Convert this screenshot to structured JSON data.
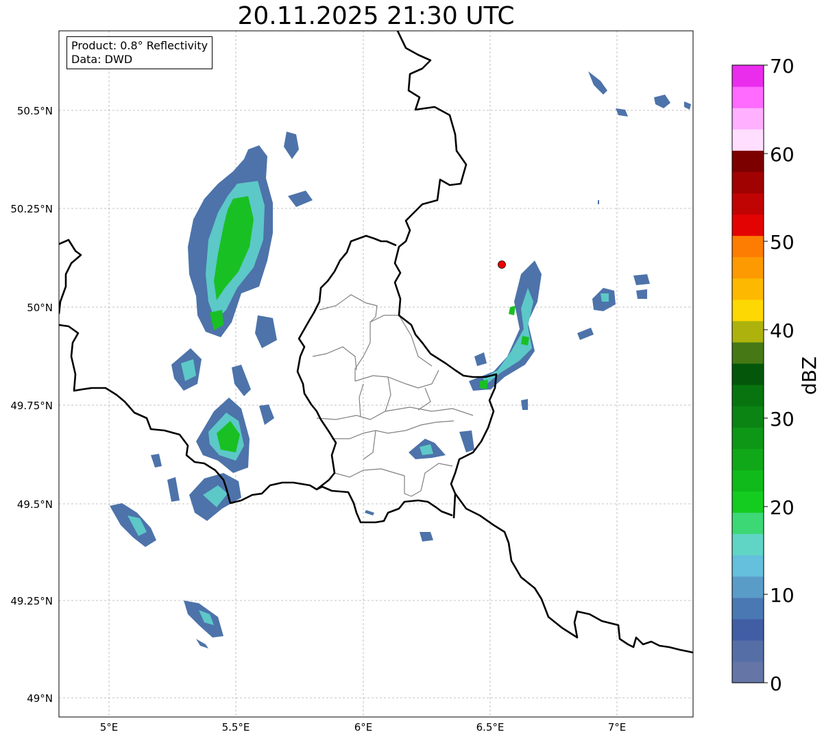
{
  "title": "20.11.2025 21:30 UTC",
  "info": {
    "product": "Product: 0.8° Reflectivity",
    "source": "Data: DWD"
  },
  "lat_axis": {
    "ticks": [
      "50.5°N",
      "50.25°N",
      "50°N",
      "49.75°N",
      "49.5°N",
      "49.25°N",
      "49°N"
    ]
  },
  "lon_axis": {
    "ticks": [
      "5°E",
      "5.5°E",
      "6°E",
      "6.5°E",
      "7°E"
    ]
  },
  "map_extent": {
    "lon": [
      4.8,
      7.3
    ],
    "lat": [
      48.95,
      50.7
    ]
  },
  "marker": {
    "lon": 6.545,
    "lat": 50.11,
    "color": "#ee0000"
  },
  "colorbar": {
    "label": "dBZ",
    "range": [
      0,
      70
    ],
    "ticks": [
      "70",
      "60",
      "50",
      "40",
      "30",
      "20",
      "10",
      "0"
    ],
    "colors": [
      "#6475a6",
      "#566ea6",
      "#415ea5",
      "#4a78b2",
      "#5a9cc8",
      "#64c0dd",
      "#60d5c5",
      "#3dd876",
      "#14cc20",
      "#10ba1a",
      "#10a718",
      "#0e9616",
      "#0b8414",
      "#08740f",
      "#04570a",
      "#467916",
      "#adb30c",
      "#fdd802",
      "#fdb902",
      "#fd9a02",
      "#fd7c02",
      "#e40303",
      "#c00303",
      "#a00202",
      "#7c0000",
      "#ffdeff",
      "#ffb1ff",
      "#ff6aff",
      "#ea2ced"
    ]
  },
  "colors": {
    "border_national": "#000000",
    "border_regional": "#808080",
    "grid": "#b0b0b0",
    "echo_weak": "#4d73aa",
    "echo_moderate": "#5dc8c8",
    "echo_strong": "#19c024"
  }
}
